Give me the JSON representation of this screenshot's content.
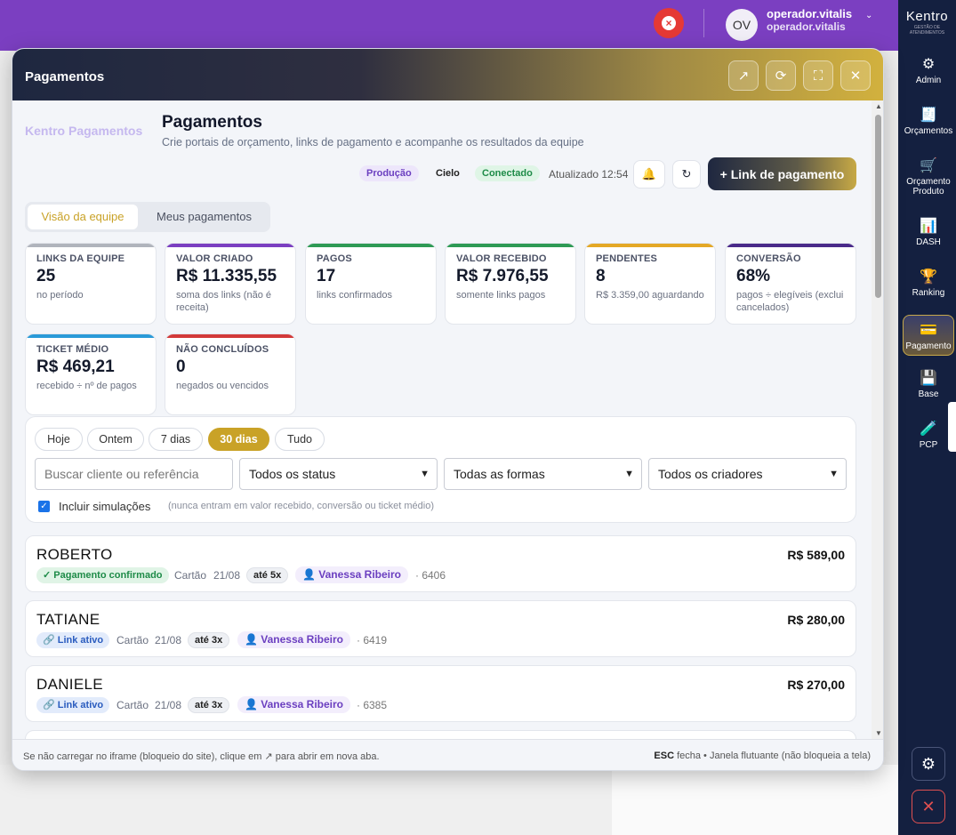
{
  "topbar": {
    "user_initials": "OV",
    "user_name": "operador.vitalis",
    "user_sub": "operador.vitalis",
    "alert_icon": "close-circle-icon",
    "chevron": "⌄"
  },
  "sidebar": {
    "logo": "Kentro",
    "logo_sub": "GESTÃO DE ATENDIMENTOS",
    "items": [
      {
        "label": "Admin",
        "icon": "⚙"
      },
      {
        "label": "Orçamentos",
        "icon": "🧾"
      },
      {
        "label": "Orçamento Produto",
        "icon": "🛒"
      },
      {
        "label": "DASH",
        "icon": "📊"
      },
      {
        "label": "Ranking",
        "icon": "🏆"
      },
      {
        "label": "Pagamento",
        "icon": "💳"
      },
      {
        "label": "Base",
        "icon": "💾"
      },
      {
        "label": "PCP",
        "icon": "🧪"
      }
    ],
    "settings_icon": "⚙",
    "close_icon": "✕"
  },
  "modal": {
    "title": "Pagamentos",
    "header_buttons": [
      "↗",
      "⟳",
      "⛶",
      "✕"
    ]
  },
  "page": {
    "brand": "Kentro Pagamentos",
    "title": "Pagamentos",
    "subtitle": "Crie portais de orçamento, links de pagamento e acompanhe os resultados da equipe",
    "env_badge": "Produção",
    "provider": "Cielo",
    "status_badge": "Conectado",
    "updated": "Atualizado 12:54",
    "bell_icon": "🔔",
    "refresh_icon": "↻",
    "new_link_label": "+ Link de pagamento",
    "tabs": [
      "Visão da equipe",
      "Meus pagamentos"
    ]
  },
  "cards": [
    {
      "label": "LINKS DA EQUIPE",
      "value": "25",
      "note": "no período",
      "color": "#b0b4bc"
    },
    {
      "label": "VALOR CRIADO",
      "value": "R$ 11.335,55",
      "note": "soma dos links (não é receita)",
      "color": "#7b3fc1"
    },
    {
      "label": "PAGOS",
      "value": "17",
      "note": "links confirmados",
      "color": "#2e9a55"
    },
    {
      "label": "VALOR RECEBIDO",
      "value": "R$ 7.976,55",
      "note": "somente links pagos",
      "color": "#2e9a55"
    },
    {
      "label": "PENDENTES",
      "value": "8",
      "note": "R$ 3.359,00 aguardando",
      "color": "#e4a826"
    },
    {
      "label": "CONVERSÃO",
      "value": "68%",
      "note": "pagos ÷ elegíveis (exclui cancelados)",
      "color": "#4a2a8a"
    },
    {
      "label": "TICKET MÉDIO",
      "value": "R$ 469,21",
      "note": "recebido ÷ nº de pagos",
      "color": "#2a9ad8"
    },
    {
      "label": "NÃO CONCLUÍDOS",
      "value": "0",
      "note": "negados ou vencidos",
      "color": "#d33a3a"
    }
  ],
  "filters": {
    "periods": [
      "Hoje",
      "Ontem",
      "7 dias",
      "30 dias",
      "Tudo"
    ],
    "active_period": "30 dias",
    "search_placeholder": "Buscar cliente ou referência",
    "status_select": "Todos os status",
    "forms_select": "Todas as formas",
    "creators_select": "Todos os criadores",
    "include_sim_label": "Incluir simulações",
    "include_sim_note": "(nunca entram em valor recebido, conversão ou ticket médio)",
    "include_sim_checked": true
  },
  "payments": [
    {
      "name": "ROBERTO",
      "amount": "R$ 589,00",
      "status": "✓ Pagamento confirmado",
      "method": "Cartão",
      "date": "21/08",
      "installments": "até 5x",
      "creator": "Vanessa Ribeiro",
      "ref": "· 6406"
    },
    {
      "name": "TATIANE",
      "amount": "R$ 280,00",
      "status": "🔗 Link ativo",
      "method": "Cartão",
      "date": "21/08",
      "installments": "até 3x",
      "creator": "Vanessa Ribeiro",
      "ref": "· 6419"
    },
    {
      "name": "DANIELE",
      "amount": "R$ 270,00",
      "status": "🔗 Link ativo",
      "method": "Cartão",
      "date": "21/08",
      "installments": "até 3x",
      "creator": "Vanessa Ribeiro",
      "ref": "· 6385"
    }
  ],
  "footer": {
    "left": "Se não carregar no iframe (bloqueio do site), clique em ↗ para abrir em nova aba.",
    "right_key": "ESC",
    "right_text": "fecha • Janela flutuante (não bloqueia a tela)"
  }
}
